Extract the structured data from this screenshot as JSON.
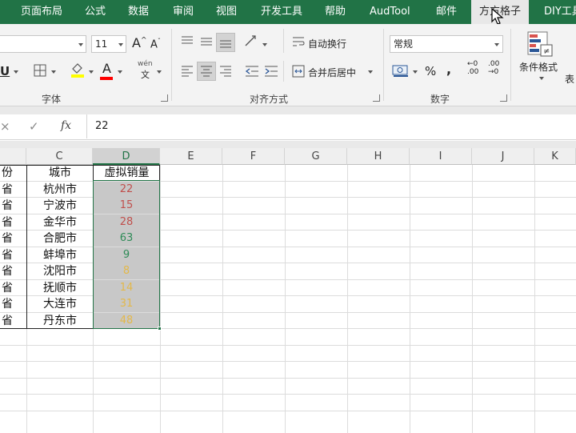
{
  "tabs": [
    {
      "label": "页面布局",
      "active": false
    },
    {
      "label": "公式",
      "active": false
    },
    {
      "label": "数据",
      "active": false
    },
    {
      "label": "审阅",
      "active": false
    },
    {
      "label": "视图",
      "active": false
    },
    {
      "label": "开发工具",
      "active": false
    },
    {
      "label": "帮助",
      "active": false
    },
    {
      "label": "AudTool",
      "active": false
    },
    {
      "label": "邮件",
      "active": false
    },
    {
      "label": "方方格子",
      "active": true
    },
    {
      "label": "DIY工具",
      "active": false
    }
  ],
  "ribbon": {
    "font": {
      "size_value": "11",
      "grow_icon": "A",
      "shrink_icon": "A",
      "underline_icon": "U",
      "font_color_letter": "A",
      "phonetic_top": "wén",
      "phonetic_bottom": "文",
      "group_label": "字体"
    },
    "alignment": {
      "wrap_text_label": "自动换行",
      "merge_center_label": "合并后居中",
      "group_label": "对齐方式"
    },
    "number": {
      "format_value": "常规",
      "percent_symbol": "%",
      "comma_symbol": ",",
      "increase_decimal_top": "←0",
      "increase_decimal_bottom": ".00",
      "decrease_decimal_top": ".00",
      "decrease_decimal_bottom": "→0",
      "group_label": "数字"
    },
    "styles": {
      "conditional_format_label": "条件格式",
      "table_label_partial": "表"
    }
  },
  "formula_bar": {
    "cancel_symbol": "×",
    "confirm_symbol": "✓",
    "fx_label": "fx",
    "value": "22"
  },
  "grid": {
    "columns": [
      "",
      "C",
      "D",
      "E",
      "F",
      "G",
      "H",
      "I",
      "J",
      "K"
    ],
    "selected_column": "D",
    "rows": [
      {
        "b": "份",
        "c": "城市",
        "d": "虚拟销量",
        "d_color": "#111111"
      },
      {
        "b": "省",
        "c": "杭州市",
        "d": "22",
        "d_color": "#c0504d"
      },
      {
        "b": "省",
        "c": "宁波市",
        "d": "15",
        "d_color": "#c0504d"
      },
      {
        "b": "省",
        "c": "金华市",
        "d": "28",
        "d_color": "#c0504d"
      },
      {
        "b": "省",
        "c": "合肥市",
        "d": "63",
        "d_color": "#2e8b57"
      },
      {
        "b": "省",
        "c": "蚌埠市",
        "d": "9",
        "d_color": "#2e8b57"
      },
      {
        "b": "省",
        "c": "沈阳市",
        "d": "8",
        "d_color": "#e3b84a"
      },
      {
        "b": "省",
        "c": "抚顺市",
        "d": "14",
        "d_color": "#e3b84a"
      },
      {
        "b": "省",
        "c": "大连市",
        "d": "31",
        "d_color": "#e3b84a"
      },
      {
        "b": "省",
        "c": "丹东市",
        "d": "48",
        "d_color": "#e3b84a"
      }
    ]
  },
  "colors": {
    "accent": "#217346",
    "selection_fill": "#c8c8c8"
  }
}
